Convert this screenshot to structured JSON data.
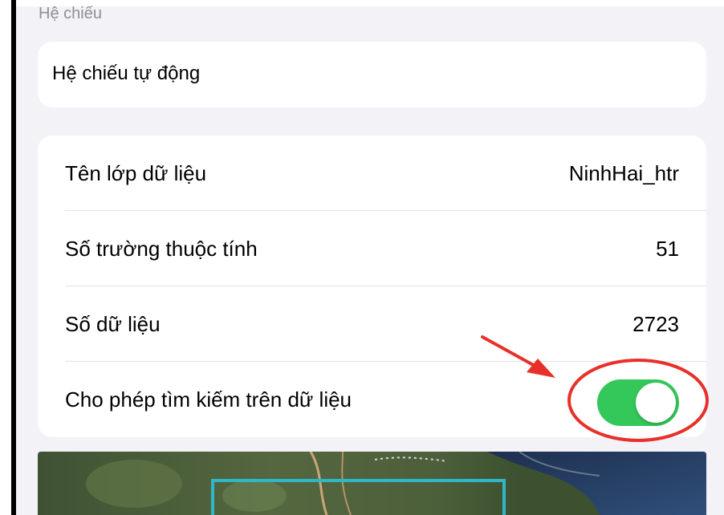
{
  "projection": {
    "section_label": "Hệ chiếu",
    "value": "Hệ chiếu tự động"
  },
  "info": {
    "rows": [
      {
        "label": "Tên lớp dữ liệu",
        "value": "NinhHai_htr"
      },
      {
        "label": "Số trường thuộc tính",
        "value": "51"
      },
      {
        "label": "Số dữ liệu",
        "value": "2723"
      }
    ],
    "search_toggle": {
      "label": "Cho phép tìm kiếm trên dữ liệu",
      "state": "on",
      "color": "#34c759"
    }
  },
  "annotation": {
    "color": "#e8302a",
    "shape": "arrow-and-circle"
  },
  "map_preview": {
    "icon": "satellite-map-thumbnail"
  }
}
